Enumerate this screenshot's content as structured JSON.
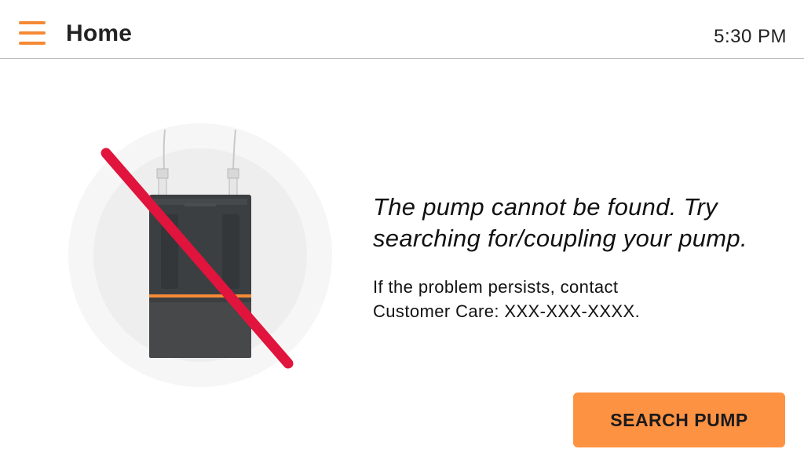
{
  "header": {
    "menu_icon": "hamburger-menu-icon",
    "title": "Home",
    "time": "5:30 PM"
  },
  "illustration": {
    "icon": "pump-not-found-icon",
    "accent_color": "#f58a36",
    "slash_color": "#e0143c"
  },
  "message": {
    "title": "The pump cannot be found. Try searching for/coupling your pump.",
    "body_line1": "If the problem persists, contact",
    "body_line2": "Customer Care: XXX-XXX-XXXX."
  },
  "actions": {
    "search_label": "SEARCH PUMP",
    "button_color": "#fd9243"
  }
}
